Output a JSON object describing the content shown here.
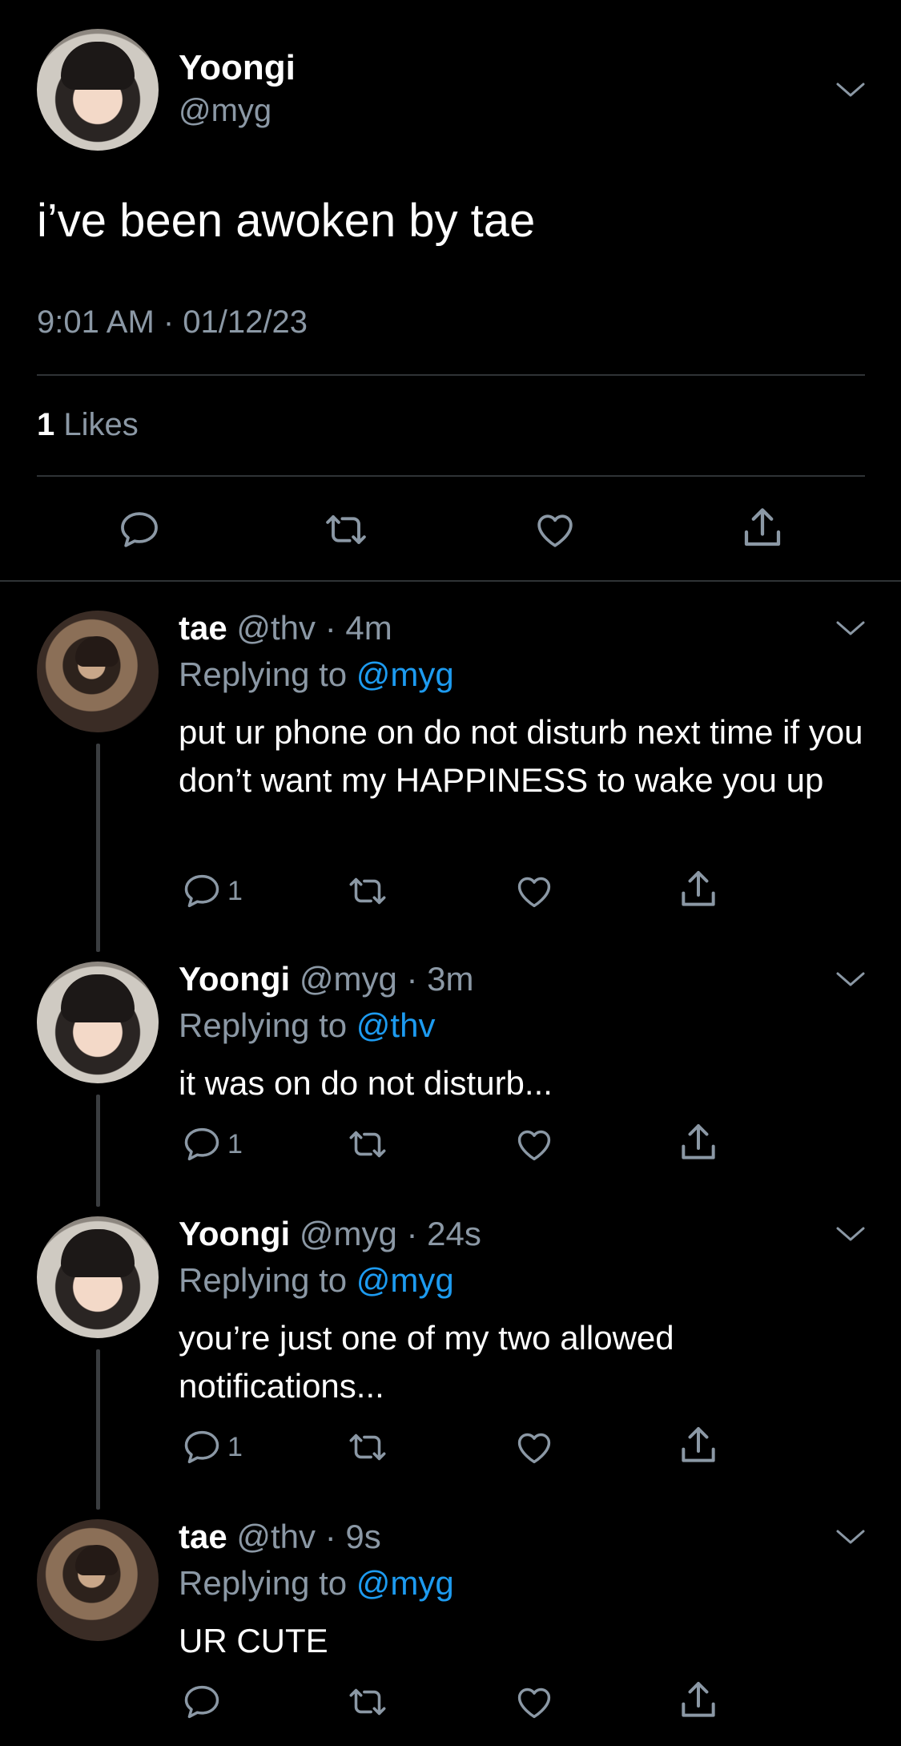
{
  "main_tweet": {
    "name": "Yoongi",
    "handle": "@myg",
    "text": "i’ve been awoken by tae",
    "timestamp": "9:01 AM · 01/12/23",
    "likes_count": "1",
    "likes_label": "Likes"
  },
  "replies": [
    {
      "name": "tae",
      "handle": "@thv",
      "time": "4m",
      "replying_prefix": "Replying to",
      "replying_to": "@myg",
      "text": "put ur phone on do not disturb next time if you don’t want my HAPPINESS to wake you up",
      "reply_count": "1"
    },
    {
      "name": "Yoongi",
      "handle": "@myg",
      "time": "3m",
      "replying_prefix": "Replying to",
      "replying_to": "@thv",
      "text": "it was on do not disturb...",
      "reply_count": "1"
    },
    {
      "name": "Yoongi",
      "handle": "@myg",
      "time": "24s",
      "replying_prefix": "Replying to",
      "replying_to": "@myg",
      "text": "you’re just one of my two allowed notifications...",
      "reply_count": "1"
    },
    {
      "name": "tae",
      "handle": "@thv",
      "time": "9s",
      "replying_prefix": "Replying to",
      "replying_to": "@myg",
      "text": "UR CUTE",
      "reply_count": ""
    }
  ],
  "colors": {
    "background": "#000000",
    "secondary_text": "#8b98a5",
    "mention": "#1d9bf0",
    "divider": "#2f3336"
  },
  "icons": [
    "chevron-down-icon",
    "reply-icon",
    "retweet-icon",
    "like-icon",
    "share-icon"
  ]
}
